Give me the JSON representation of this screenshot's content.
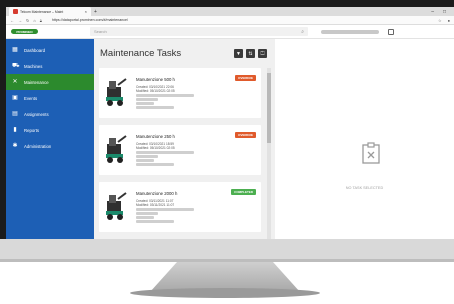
{
  "browser": {
    "tab_title": "Telcom Maintenance – Maint",
    "tab_close": "×",
    "new_tab": "+",
    "url": "https://dataportal.prominen.com/#/maintenance/",
    "window_controls": [
      "–",
      "□"
    ]
  },
  "header": {
    "logo_text": "PROMINEN",
    "search_placeholder": "Search"
  },
  "sidebar": {
    "items": [
      {
        "label": "Dashboard",
        "icon": "grid-icon",
        "glyph": "▦"
      },
      {
        "label": "Machines",
        "icon": "truck-icon",
        "glyph": "⛟"
      },
      {
        "label": "Maintenance",
        "icon": "wrench-icon",
        "glyph": "✕"
      },
      {
        "label": "Events",
        "icon": "calendar-icon",
        "glyph": "▣"
      },
      {
        "label": "Assignments",
        "icon": "documents-icon",
        "glyph": "▤"
      },
      {
        "label": "Reports",
        "icon": "bar-chart-icon",
        "glyph": "▮"
      },
      {
        "label": "Administration",
        "icon": "gear-icon",
        "glyph": "✱"
      }
    ],
    "active_index": 2
  },
  "main": {
    "title": "Maintenance Tasks",
    "tools": [
      {
        "icon": "filter-icon",
        "glyph": "▼"
      },
      {
        "icon": "sort-icon",
        "glyph": "⇅"
      },
      {
        "icon": "export-icon",
        "glyph": "⏍"
      }
    ],
    "tasks": [
      {
        "title": "Manutenzione 500 h",
        "created": "Created: 03/10/2021 22:06",
        "modified": "Modified: 05/10/2021 02:05",
        "badge": "OVERDUE",
        "badge_color": "#e05a2b"
      },
      {
        "title": "Manutenzione 250 h",
        "created": "Created: 03/10/2021 18:59",
        "modified": "Modified: 05/10/2021 02:05",
        "badge": "OVERDUE",
        "badge_color": "#e05a2b"
      },
      {
        "title": "Manutenzione 2000 h",
        "created": "Created: 03/11/2021 11:07",
        "modified": "Modified: 03/11/2021 11:07",
        "badge": "COMPLETED",
        "badge_color": "#4caf50"
      }
    ]
  },
  "detail": {
    "empty_text": "NO TASK SELECTED",
    "icon": "clipboard-icon"
  },
  "colors": {
    "sidebar": "#1d5fb5",
    "active_nav": "#2c8a2d",
    "overdue": "#e05a2b",
    "completed": "#4caf50"
  }
}
